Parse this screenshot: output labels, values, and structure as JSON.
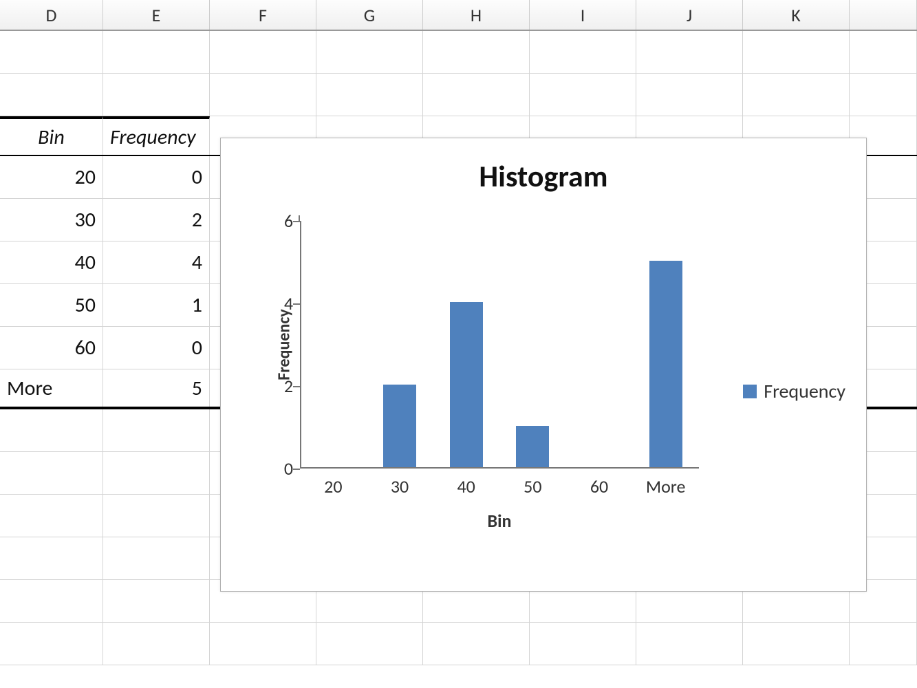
{
  "columns": [
    "D",
    "E",
    "F",
    "G",
    "H",
    "I",
    "J",
    "K"
  ],
  "table": {
    "headers": {
      "bin": "Bin",
      "freq": "Frequency"
    },
    "rows": [
      {
        "bin": "20",
        "freq": "0"
      },
      {
        "bin": "30",
        "freq": "2"
      },
      {
        "bin": "40",
        "freq": "4"
      },
      {
        "bin": "50",
        "freq": "1"
      },
      {
        "bin": "60",
        "freq": "0"
      },
      {
        "bin": "More",
        "freq": "5"
      }
    ]
  },
  "chart_data": {
    "type": "bar",
    "title": "Histogram",
    "xlabel": "Bin",
    "ylabel": "Frequency",
    "categories": [
      "20",
      "30",
      "40",
      "50",
      "60",
      "More"
    ],
    "values": [
      0,
      2,
      4,
      1,
      0,
      5
    ],
    "ylim": [
      0,
      6
    ],
    "yticks": [
      0,
      2,
      4,
      6
    ],
    "legend": [
      "Frequency"
    ],
    "bar_color": "#4f81bd"
  }
}
